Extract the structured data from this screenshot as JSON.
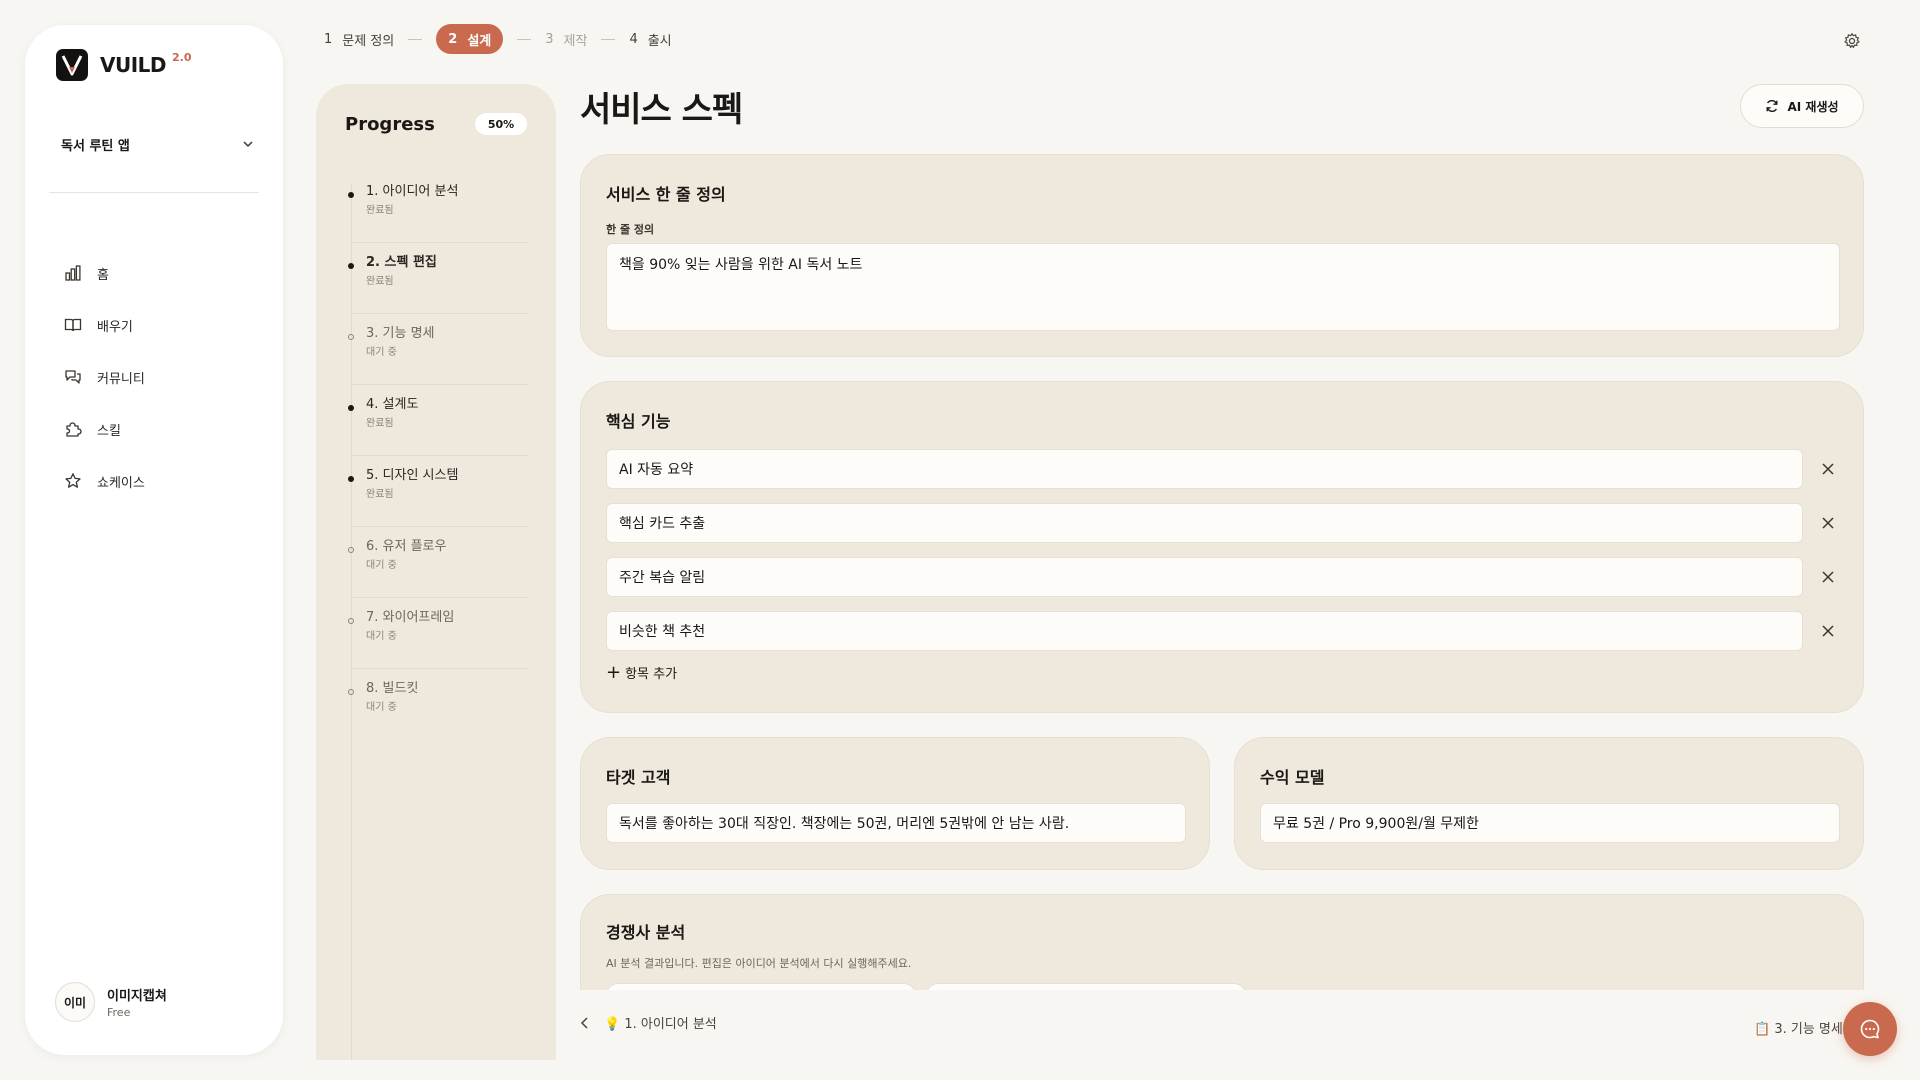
{
  "brand": {
    "name": "VUILD",
    "version": "2.0"
  },
  "project": {
    "name": "독서 루틴 앱"
  },
  "nav": [
    {
      "label": "홈",
      "icon": "chart-icon"
    },
    {
      "label": "배우기",
      "icon": "book-icon"
    },
    {
      "label": "커뮤니티",
      "icon": "chat-bubbles-icon"
    },
    {
      "label": "스킬",
      "icon": "puzzle-icon"
    },
    {
      "label": "쇼케이스",
      "icon": "star-icon"
    }
  ],
  "user": {
    "avatar": "이미",
    "name": "이미지캡쳐",
    "plan": "Free"
  },
  "stepper": [
    {
      "num": "1",
      "label": "문제 정의",
      "state": "done"
    },
    {
      "num": "2",
      "label": "설계",
      "state": "active"
    },
    {
      "num": "3",
      "label": "제작",
      "state": "muted"
    },
    {
      "num": "4",
      "label": "출시",
      "state": "done"
    }
  ],
  "progress": {
    "title": "Progress",
    "percent_label": "50%",
    "percent": 50,
    "items": [
      {
        "label": "1. 아이디어 분석",
        "status": "완료됨",
        "state": "done"
      },
      {
        "label": "2. 스펙 편집",
        "status": "완료됨",
        "state": "current"
      },
      {
        "label": "3. 기능 명세",
        "status": "대기 중",
        "state": "pending"
      },
      {
        "label": "4. 설계도",
        "status": "완료됨",
        "state": "done"
      },
      {
        "label": "5. 디자인 시스템",
        "status": "완료됨",
        "state": "done"
      },
      {
        "label": "6. 유저 플로우",
        "status": "대기 중",
        "state": "pending"
      },
      {
        "label": "7. 와이어프레임",
        "status": "대기 중",
        "state": "pending"
      },
      {
        "label": "8. 빌드킷",
        "status": "대기 중",
        "state": "pending"
      }
    ]
  },
  "main": {
    "title": "서비스 스펙",
    "regen_label": "AI 재생성",
    "one_liner": {
      "title": "서비스 한 줄 정의",
      "field_label": "한 줄 정의",
      "value": "책을 90% 잊는 사람을 위한 AI 독서 노트"
    },
    "features": {
      "title": "핵심 기능",
      "items": [
        "AI 자동 요약",
        "핵심 카드 추출",
        "주간 복습 알림",
        "비슷한 책 추천"
      ],
      "add_label": "항목 추가"
    },
    "target": {
      "title": "타겟 고객",
      "value": "독서를 좋아하는 30대 직장인. 책장에는 50권, 머리엔 5권밖에 안 남는 사람."
    },
    "revenue": {
      "title": "수익 모델",
      "value": "무료 5권 / Pro 9,900원/월 무제한"
    },
    "competitors": {
      "title": "경쟁사 분석",
      "note": "AI 분석 결과입니다. 편집은 아이디어 분석에서 다시 실행해주세요."
    }
  },
  "footer": {
    "prev_label": "💡 1. 아이디어 분석",
    "next_label": "📋 3. 기능 명세"
  },
  "colors": {
    "accent": "#c96a4e",
    "card": "#efe8dd",
    "background": "#f8f6f2"
  }
}
